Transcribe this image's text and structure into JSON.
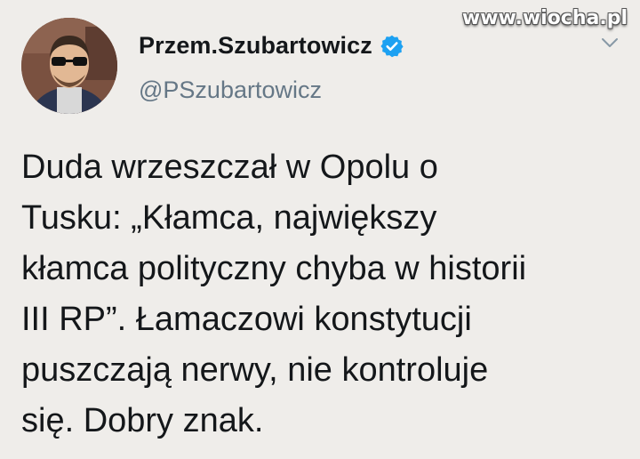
{
  "watermark": "www.wiocha.pl",
  "tweet": {
    "display_name": "Przem.Szubartowicz",
    "handle": "@PSzubartowicz",
    "text": "Duda wrzeszczał w Opolu o\nTusku: „Kłamca, największy\nkłamca polityczny chyba w historii\nIII RP”. Łamaczowi konstytucji\npuszczają nerwy, nie kontroluje\nsię. Dobry znak.",
    "verified_icon": "verified-badge-icon",
    "menu_icon": "chevron-down-icon",
    "accent_color": "#1da1f2"
  }
}
